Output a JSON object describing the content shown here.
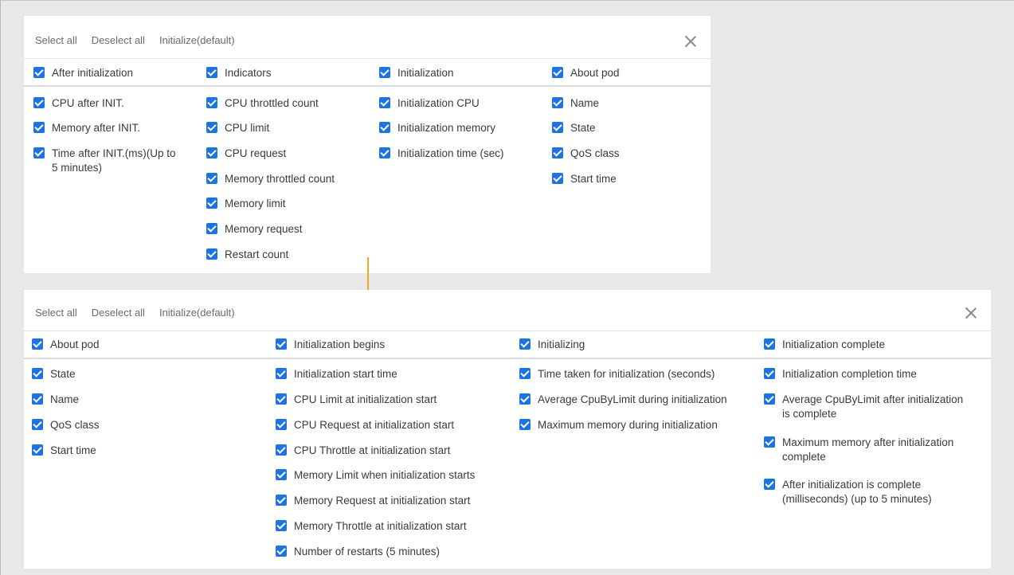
{
  "top_panel": {
    "toolbar": {
      "select_all": "Select all",
      "deselect_all": "Deselect all",
      "initialize": "Initialize(default)"
    },
    "headers": [
      "After initialization",
      "Indicators",
      "Initialization",
      "About pod"
    ],
    "columns": [
      [
        "CPU after INIT.",
        "Memory after INIT.",
        "Time after INIT.(ms)(Up to 5 minutes)"
      ],
      [
        "CPU throttled count",
        "CPU limit",
        "CPU request",
        "Memory throttled count",
        "Memory limit",
        "Memory request",
        "Restart count"
      ],
      [
        "Initialization CPU",
        "Initialization memory",
        "Initialization time (sec)"
      ],
      [
        "Name",
        "State",
        "QoS class",
        "Start time"
      ]
    ]
  },
  "bottom_panel": {
    "toolbar": {
      "select_all": "Select all",
      "deselect_all": "Deselect all",
      "initialize": "Initialize(default)"
    },
    "headers": [
      "About pod",
      "Initialization begins",
      "Initializing",
      "Initialization complete"
    ],
    "columns": [
      [
        "State",
        "Name",
        "QoS class",
        "Start time"
      ],
      [
        "Initialization start time",
        "CPU Limit at initialization start",
        "CPU Request at initialization start",
        "CPU Throttle at initialization start",
        "Memory Limit when initialization starts",
        "Memory Request at initialization start",
        "Memory Throttle at initialization start",
        "Number of restarts (5 minutes)"
      ],
      [
        "Time taken for initialization (seconds)",
        "Average CpuByLimit during initialization",
        "Maximum memory during initialization"
      ],
      [
        "Initialization completion time",
        "Average CpuByLimit after initialization is complete",
        "Maximum memory after initialization complete",
        "After initialization is complete (milliseconds) (up to 5 minutes)"
      ]
    ]
  },
  "colors": {
    "checkbox": "#1a73e8",
    "arrow": "#f3a81d",
    "background": "#e8e8e8"
  },
  "icons": {
    "close": "close-icon",
    "checkbox": "checkbox-checked-icon",
    "arrow": "arrow-down-icon"
  }
}
